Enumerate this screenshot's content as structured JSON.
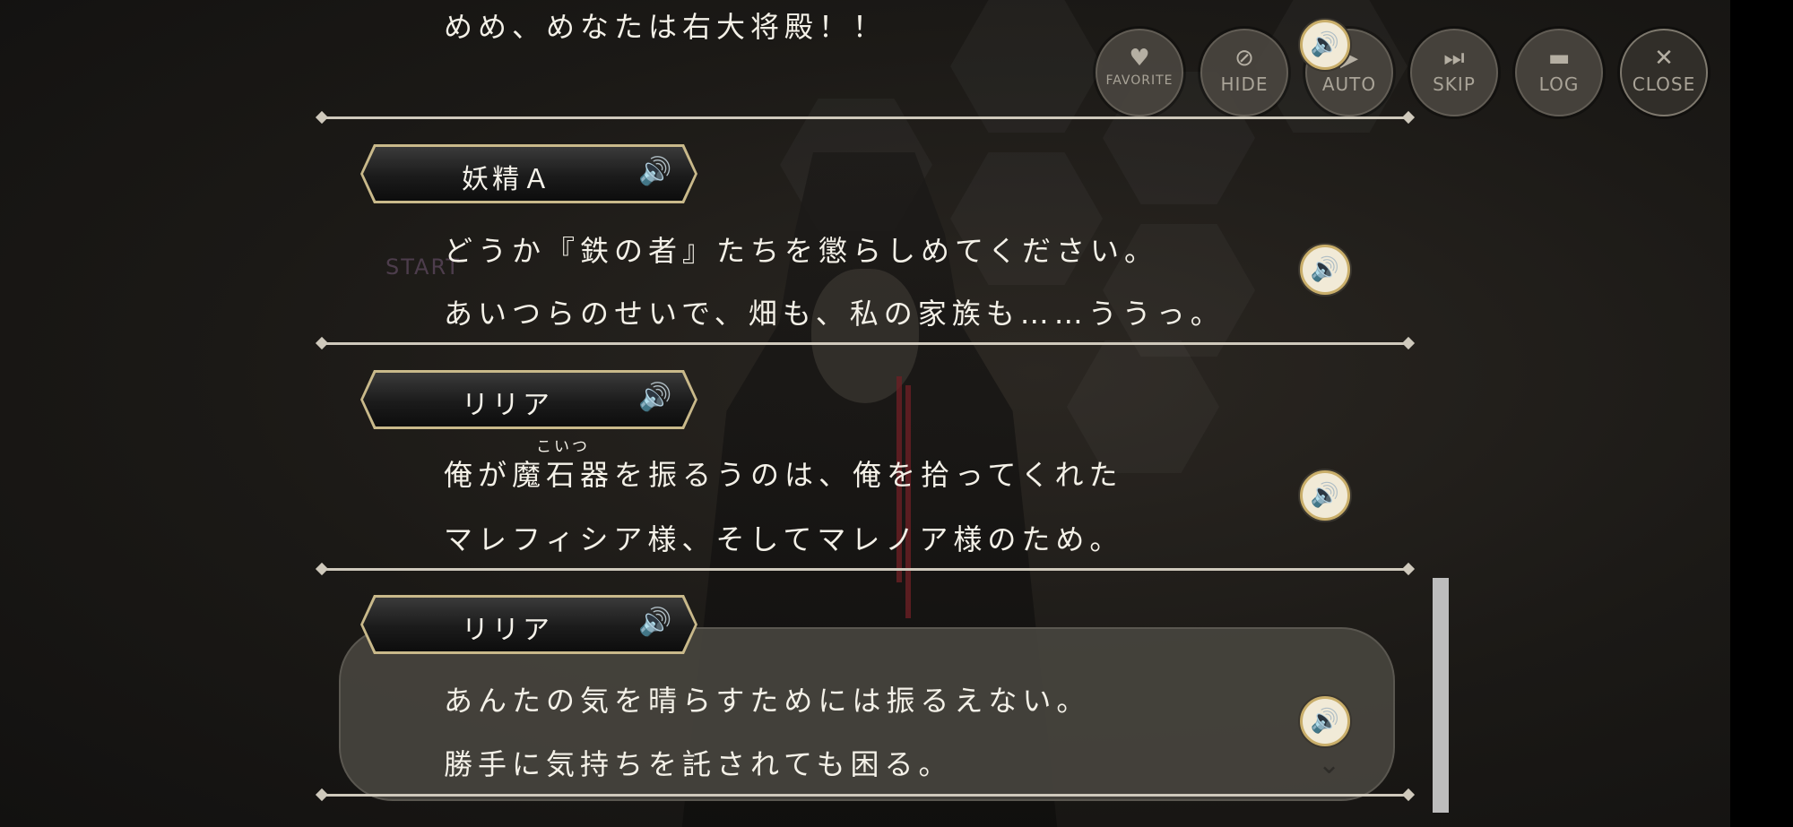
{
  "toolbar": {
    "favorite": {
      "label": "FAVORITE",
      "icon": "heart-icon"
    },
    "hide": {
      "label": "HIDE",
      "icon": "eye-slash-icon"
    },
    "auto": {
      "label": "AUTO",
      "icon": "play-icon"
    },
    "skip": {
      "label": "SKIP",
      "icon": "skip-icon"
    },
    "log": {
      "label": "LOG",
      "icon": "chat-bubble-icon"
    },
    "close": {
      "label": "CLOSE",
      "icon": "x-icon"
    }
  },
  "background": {
    "start_label": "START"
  },
  "log": {
    "entries": [
      {
        "speaker": "",
        "lines": [
          "めめ、めなたは右大将殿！！"
        ]
      },
      {
        "speaker": "妖精Ａ",
        "lines": [
          "どうか『鉄の者』たちを懲らしめてください。",
          "あいつらのせいで、畑も、私の家族も……ううっ。"
        ]
      },
      {
        "speaker": "リリア",
        "ruby": "こいつ",
        "lines": [
          "俺が魔石器を振るうのは、俺を拾ってくれた",
          "マレフィシア様、そしてマレノア様のため。"
        ]
      },
      {
        "speaker": "リリア",
        "lines": [
          "あんたの気を晴らすためには振るえない。",
          "勝手に気持ちを託されても困る。"
        ]
      }
    ]
  },
  "colors": {
    "gold_border": "#c9b98a",
    "voice_button": "#f1ead7",
    "scroll_thumb": "#bdbdbd"
  }
}
